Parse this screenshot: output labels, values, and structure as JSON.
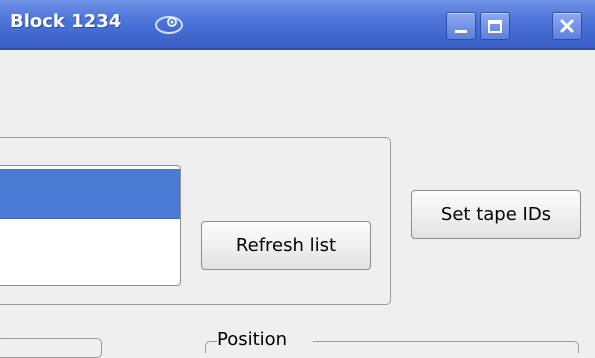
{
  "window": {
    "title": "Block 1234",
    "app_icon": "opensuse-chameleon-icon",
    "controls": {
      "minimize_icon": "minimize-icon",
      "maximize_icon": "maximize-icon",
      "close_icon": "close-icon"
    }
  },
  "buttons": {
    "refresh_label": "Refresh list",
    "set_tape_ids_label": "Set tape IDs"
  },
  "position_group": {
    "label": "Position"
  },
  "colors": {
    "titlebar": "#4a72d8",
    "selection": "#4a7cd6",
    "background": "#efefef"
  }
}
